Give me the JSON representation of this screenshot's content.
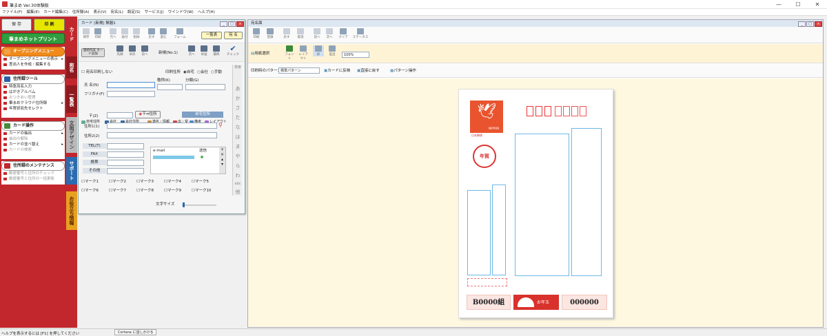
{
  "window": {
    "title": "筆まめ Ver.30体験版",
    "min": "—",
    "max": "☐",
    "close": "✕"
  },
  "menu": [
    "ファイル(F)",
    "編集(E)",
    "カード編集(C)",
    "住所録(A)",
    "表示(V)",
    "宛名(L)",
    "設定(S)",
    "サービス(J)",
    "ウインドウ(W)",
    "ヘルプ(H)"
  ],
  "left": {
    "save": "保 存",
    "print": "印 刷",
    "net_print": "筆まめネットプリント",
    "opening": {
      "title": "オープニングメニュー",
      "items": [
        "オープニングメニューの表示",
        "差出人を作成・編集する"
      ]
    },
    "addressbook": {
      "title": "住所録ツール",
      "items": [
        "特急宛名入力",
        "はがきアルバム",
        "おつきあい管理",
        "筆まめクラウド住所録",
        "年賀状宛先セレクト"
      ]
    },
    "card": {
      "title": "カード操作",
      "items": [
        "カードの抽出",
        "抽出の解除",
        "カードの並べ替え",
        "カードの検索"
      ]
    },
    "maint": {
      "title": "住所録のメンテナンス",
      "items": [
        "郵便番号と住所のチェック",
        "郵便番号と住所の一括更新"
      ]
    }
  },
  "vtabs": [
    "カード",
    "宛名",
    "一覧表",
    "文面デザイン",
    "サポート",
    "お役立ち情報"
  ],
  "cardwin": {
    "title": "カード [新規] 無題1",
    "toolbar": [
      "保存",
      "印刷",
      "元へ",
      "貼付",
      "削除",
      "戻す",
      "進む",
      "フォーム"
    ],
    "list_btn": "一覧表",
    "name_btn": "宛 名",
    "nav": {
      "cards": "連続作成 カード追加",
      "first": "先頭",
      "prev_fast": "早戻",
      "prev": "前へ",
      "count": "新規(No.1)",
      "next": "次へ",
      "next_fast": "早送",
      "last": "最終",
      "check": "チェック"
    },
    "no_print": "宛名印刷しない",
    "print_addr": "印刷住所",
    "opt_home": "自宅",
    "opt_company": "会社",
    "opt_manual": "手動",
    "name_label": "氏 名(N)",
    "furi_label": "フリガナ(F)",
    "title_label": "敬称(K)",
    "class_label": "分類(G)",
    "tabs": [
      "自宅住所",
      "会社",
      "会社住所",
      "連名・情報",
      "出・受",
      "備考",
      "レイアウト"
    ],
    "zip_label": "〒(Z)",
    "addr_search": "〒⇔住所",
    "home_badge": "自宅住所",
    "addr1": "住所1(1)",
    "addr2": "住所2(2)",
    "contacts": [
      "TEL(T)",
      "FAX",
      "携帯",
      "その他"
    ],
    "email": "e-mail",
    "send": "送信",
    "marks": [
      "マーク1",
      "マーク2",
      "マーク3",
      "マーク4",
      "マーク5",
      "マーク6",
      "マーク7",
      "マーク8",
      "マーク9",
      "マーク10"
    ],
    "fontsize": "文字サイズ",
    "kana": [
      "検索",
      "あ",
      "か",
      "さ",
      "た",
      "な",
      "は",
      "ま",
      "や",
      "ら",
      "わ",
      "abc",
      "他"
    ]
  },
  "editor": {
    "title": "宛名面",
    "tb1": [
      "印刷",
      "登録",
      "戻す",
      "取消",
      "前へ",
      "次へ",
      "クリア",
      "ステータス"
    ],
    "tb2": [
      "用紙選択",
      "フォント",
      "レイアウト",
      "枠",
      "差出"
    ],
    "zoom": "100%",
    "pattern_label": "印刷時のパターン",
    "pattern": "標準パターン",
    "reflect": "カードに反映",
    "revert": "直接に戻す",
    "pattern_op": "パターン操作"
  },
  "postcard": {
    "nippon": "NIPPON",
    "postal": "日本郵便",
    "nenga": "年賀",
    "lottery_left": "B0000組",
    "lottery_right": "000000",
    "otoshidama": "お年玉"
  },
  "status": {
    "help": "ヘルプを表示するには [F1] を押してください",
    "tooltip": "Cortana に話しかける"
  }
}
